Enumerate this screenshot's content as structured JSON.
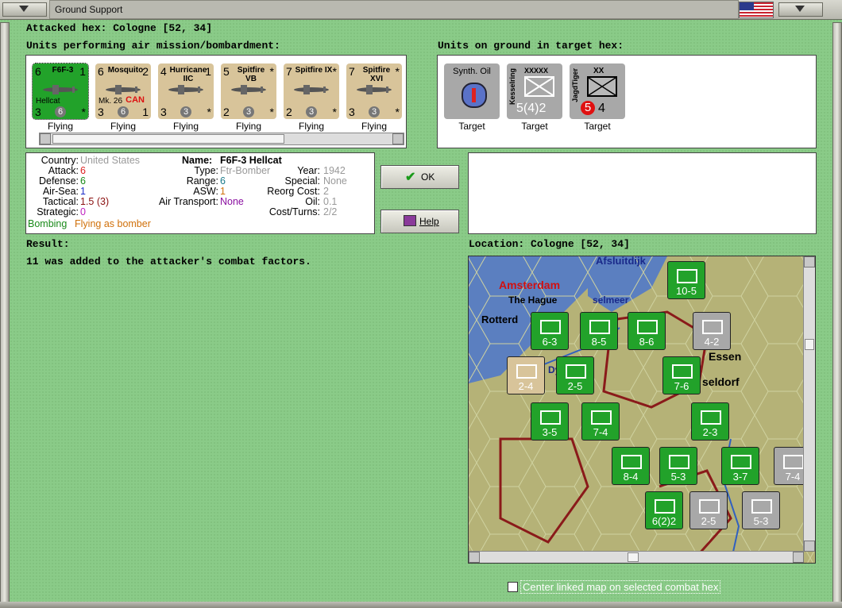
{
  "window": {
    "title": "Ground Support"
  },
  "header": {
    "attacked_hex": "Attacked hex: Cologne  [52, 34]",
    "air_units_heading": "Units performing air mission/bombardment:",
    "ground_units_heading": "Units on ground in target hex:"
  },
  "air_units": [
    {
      "tl": "6",
      "tr": "1",
      "name": "F6F-3",
      "sub": "Hellcat",
      "bl": "3",
      "bc": "6",
      "br": "*",
      "status": "Flying",
      "color": "green"
    },
    {
      "tl": "6",
      "tr": "2",
      "name": "Mosquito",
      "sub": "Mk. 26",
      "can": "CAN",
      "bl": "3",
      "bc": "6",
      "br": "1",
      "status": "Flying",
      "color": "tan"
    },
    {
      "tl": "4",
      "tr": "1",
      "name": "Hurricane IIC",
      "sub": "",
      "bl": "3",
      "bc": "3",
      "br": "*",
      "status": "Flying",
      "color": "tan"
    },
    {
      "tl": "5",
      "tr": "*",
      "name": "Spitfire VB",
      "sub": "",
      "bl": "2",
      "bc": "3",
      "br": "*",
      "status": "Flying",
      "color": "tan"
    },
    {
      "tl": "7",
      "tr": "*",
      "name": "Spitfire IX",
      "sub": "",
      "bl": "2",
      "bc": "3",
      "br": "*",
      "status": "Flying",
      "color": "tan"
    },
    {
      "tl": "7",
      "tr": "*",
      "name": "Spitfire XVI",
      "sub": "",
      "bl": "3",
      "bc": "3",
      "br": "*",
      "status": "Flying",
      "color": "tan"
    }
  ],
  "ground_units": [
    {
      "name": "Synth. Oil",
      "status": "Target"
    },
    {
      "side": "Kesselring",
      "size": "XXXXX",
      "value": "5(4)2",
      "status": "Target"
    },
    {
      "side": "JagdTiger",
      "size": "XX",
      "red": "5",
      "value": "4",
      "status": "Target"
    }
  ],
  "details": {
    "country_label": "Country:",
    "country": "United States",
    "attack_label": "Attack:",
    "attack": "6",
    "defense_label": "Defense:",
    "defense": "6",
    "airsea_label": "Air-Sea:",
    "airsea": "1",
    "tactical_label": "Tactical:",
    "tactical": "1.5 (3)",
    "strategic_label": "Strategic:",
    "strategic": "0",
    "bombing": "Bombing",
    "flying_bomber": "Flying as bomber",
    "name_label": "Name:",
    "name": "F6F-3 Hellcat",
    "type_label": "Type:",
    "type": "Ftr-Bomber",
    "range_label": "Range:",
    "range": "6",
    "asw_label": "ASW:",
    "asw": "1",
    "air_transport_label": "Air Transport:",
    "air_transport": "None",
    "year_label": "Year:",
    "year": "1942",
    "special_label": "Special:",
    "special": "None",
    "reorg_label": "Reorg Cost:",
    "reorg": "2",
    "oil_label": "Oil:",
    "oil": "0.1",
    "cost_label": "Cost/Turns:",
    "cost": "2/2"
  },
  "buttons": {
    "ok": "OK",
    "help": "Help"
  },
  "result": {
    "label": "Result:",
    "text": "11 was added to the attacker's combat factors."
  },
  "location": {
    "label": "Location:  Cologne  [52, 34]"
  },
  "map": {
    "places": [
      "Afsluitdijk",
      "Amsterdam",
      "The Hague",
      "Rotterd",
      "Essen",
      "seldorf",
      "Dy",
      "selmeer"
    ],
    "counters": [
      {
        "t": "10-5"
      },
      {
        "t": "6-3"
      },
      {
        "t": "8-5"
      },
      {
        "t": "8-6"
      },
      {
        "t": "4-2"
      },
      {
        "t": "2-4"
      },
      {
        "t": "2-5"
      },
      {
        "t": "7-6"
      },
      {
        "t": "7-4"
      },
      {
        "t": "3-5"
      },
      {
        "t": "2-3"
      },
      {
        "t": "8-4"
      },
      {
        "t": "5-3"
      },
      {
        "t": "3-7"
      },
      {
        "t": "7-4"
      },
      {
        "t": "6(2)2"
      },
      {
        "t": "2-5"
      },
      {
        "t": "5-3"
      }
    ]
  },
  "center_checkbox": {
    "label": "Center linked map on selected combat hex"
  },
  "colors": {
    "bg": "#8acb88",
    "green_unit": "#22a22a",
    "tan_unit": "#d8c49a",
    "grey_unit": "#a8a8a8"
  }
}
